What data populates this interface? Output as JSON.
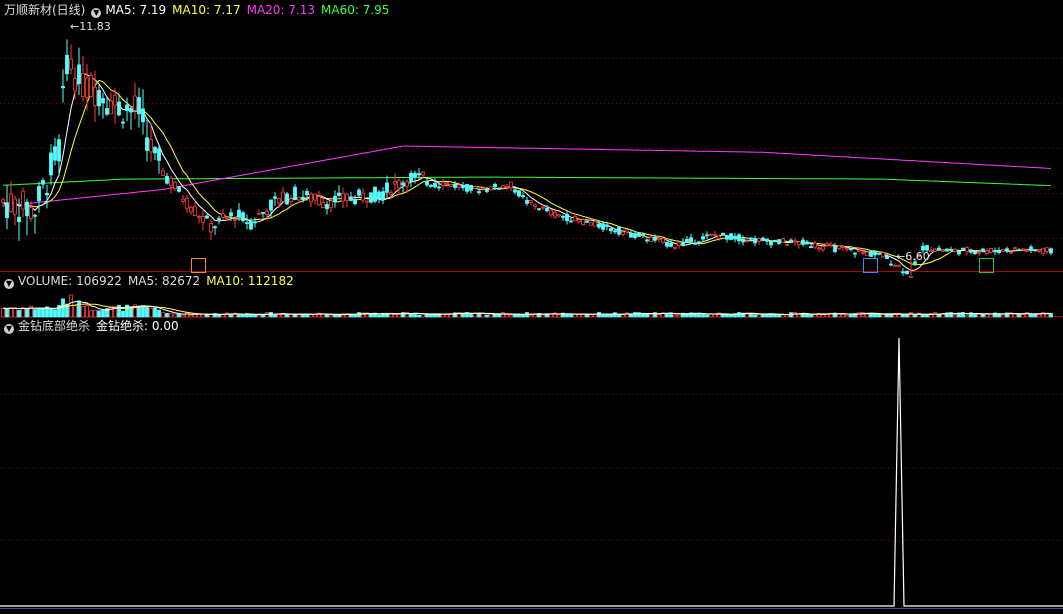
{
  "main": {
    "title": "万顺新材(日线)",
    "ma5_label": "MA5:",
    "ma5_value": "7.19",
    "ma10_label": "MA10:",
    "ma10_value": "7.17",
    "ma20_label": "MA20:",
    "ma20_value": "7.13",
    "ma60_label": "MA60:",
    "ma60_value": "7.95",
    "high_label": "11.83",
    "low_label": "6.60",
    "tags": [
      {
        "text": "定",
        "color": "#ff8c1a"
      },
      {
        "text": "财",
        "color": "#3f8cff"
      },
      {
        "text": "港",
        "color": "#22cc22"
      }
    ]
  },
  "volume": {
    "label": "VOLUME:",
    "value": "106922",
    "ma5_label": "MA5:",
    "ma5_value": "82672",
    "ma10_label": "MA10:",
    "ma10_value": "112182"
  },
  "indicator": {
    "name": "金钻底部绝杀",
    "line_label": "金钻绝杀:",
    "line_value": "0.00"
  },
  "colors": {
    "up": "#ff3b3b",
    "down": "#54ffff",
    "ma5": "#ffffff",
    "ma10": "#ffff3c",
    "ma20": "#ff3cff",
    "ma60": "#3cff3c",
    "grid": "#7a0000",
    "border": "#b00000"
  },
  "chart_data": [
    {
      "type": "candlestick",
      "ylim": [
        6.3,
        12.3
      ],
      "ma_trend": {
        "ma20": [
          [
            0,
            7.8
          ],
          [
            40,
            8.2
          ],
          [
            100,
            9.25
          ],
          [
            190,
            9.1
          ],
          [
            300,
            8.5
          ],
          [
            360,
            7.9
          ],
          [
            500,
            6.7
          ],
          [
            550,
            6.6
          ]
        ],
        "ma60": [
          [
            0,
            8.3
          ],
          [
            30,
            8.45
          ],
          [
            120,
            8.5
          ],
          [
            220,
            8.45
          ],
          [
            300,
            8.15
          ],
          [
            380,
            7.5
          ],
          [
            440,
            7.0
          ],
          [
            500,
            6.7
          ],
          [
            550,
            6.45
          ]
        ]
      }
    },
    {
      "type": "bar",
      "label": "VOLUME",
      "last": 106922,
      "ma5": 82672,
      "ma10": 112182
    },
    {
      "type": "line",
      "label": "金钻绝杀",
      "last": 0.0,
      "spike_value": 1.0
    }
  ]
}
